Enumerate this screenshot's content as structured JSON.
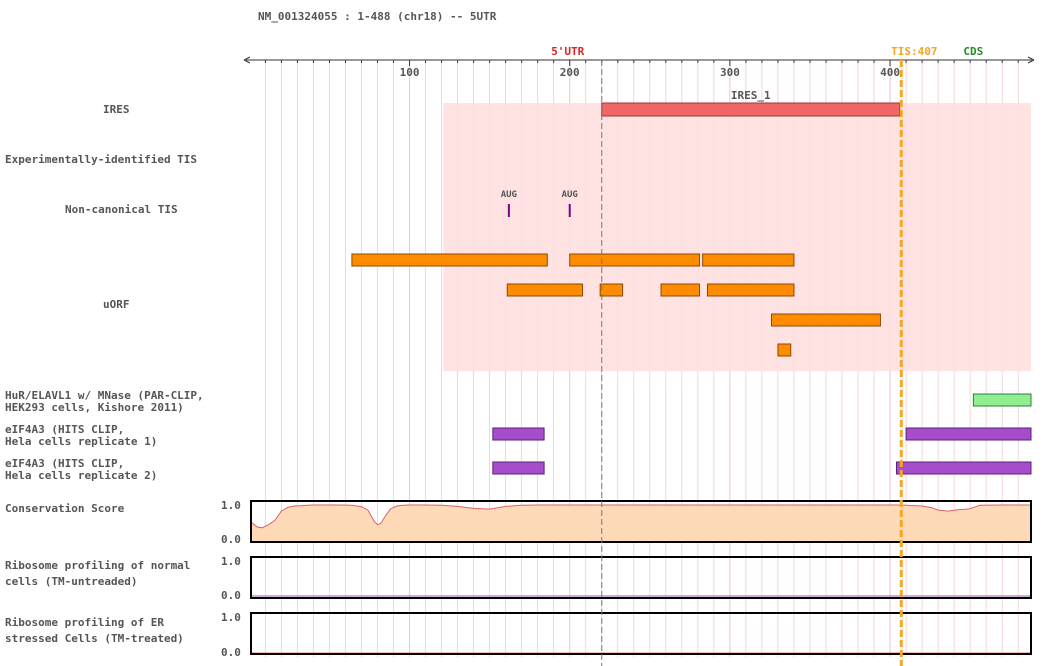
{
  "header": {
    "title": "NM_001324055 : 1-488 (chr18) -- 5UTR"
  },
  "axis": {
    "min": 1,
    "max": 488,
    "major_ticks": [
      100,
      200,
      300,
      400
    ],
    "utr_label": "5'UTR",
    "utr_boundary": 220,
    "tis_label": "TIS:407",
    "tis_position": 407,
    "cds_label": "CDS",
    "cds_label_position": 452
  },
  "colors": {
    "ires_region": "#ffdede",
    "ires_bar": "#f06666",
    "uorf": "#ff8c00",
    "aug_mark": "#800080",
    "hur": "#90ee90",
    "eif4a3": "#a64dcc",
    "conservation_fill": "#ffdab9",
    "conservation_line": "#e06060",
    "tis_line": "#f5a623",
    "utr_label": "#dd2222",
    "cds_label": "#228b22",
    "grid": "#f0c4c4"
  },
  "tracks": {
    "ires": {
      "label": "IRES",
      "region": [
        121,
        488
      ],
      "feature": {
        "name": "IRES_1",
        "start": 220,
        "end": 406
      }
    },
    "exp_tis": {
      "label": "Experimentally-identified TIS"
    },
    "noncanonical_tis": {
      "label": "Non-canonical TIS",
      "marks": [
        {
          "label": "AUG",
          "pos": 162
        },
        {
          "label": "AUG",
          "pos": 200
        }
      ]
    },
    "uorf": {
      "label": "uORF",
      "rows": [
        [
          [
            64,
            186
          ],
          [
            200,
            281
          ],
          [
            283,
            340
          ]
        ],
        [
          [
            161,
            208
          ],
          [
            219,
            233
          ],
          [
            257,
            281
          ],
          [
            286,
            340
          ]
        ],
        [
          [
            326,
            394
          ]
        ],
        [
          [
            330,
            338
          ]
        ]
      ]
    },
    "hur": {
      "label_lines": [
        "HuR/ELAVL1 w/ MNase (PAR-CLIP,",
        "HEK293 cells, Kishore 2011)"
      ],
      "features": [
        [
          452,
          488
        ]
      ]
    },
    "eif4a3_r1": {
      "label_lines": [
        "eIF4A3 (HITS CLIP,",
        "Hela cells replicate 1)"
      ],
      "features": [
        [
          152,
          184
        ],
        [
          410,
          488
        ]
      ]
    },
    "eif4a3_r2": {
      "label_lines": [
        "eIF4A3 (HITS CLIP,",
        "Hela cells replicate 2)"
      ],
      "features": [
        [
          152,
          184
        ],
        [
          404,
          488
        ]
      ]
    }
  },
  "chart_data": {
    "type": "area",
    "title": "Conservation Score",
    "xlabel": "",
    "ylabel": "",
    "ylim": [
      0,
      1
    ],
    "ytick_labels": [
      "1.0",
      "0.0"
    ],
    "x": [
      1,
      5,
      8,
      12,
      16,
      20,
      24,
      28,
      32,
      36,
      40,
      48,
      56,
      64,
      70,
      74,
      76,
      78,
      80,
      82,
      85,
      88,
      92,
      96,
      100,
      110,
      120,
      130,
      140,
      150,
      160,
      170,
      180,
      190,
      200,
      220,
      260,
      300,
      340,
      380,
      405,
      410,
      420,
      426,
      430,
      436,
      442,
      446,
      450,
      456,
      470,
      488
    ],
    "series": [
      {
        "values": [
          0.5,
          0.35,
          0.33,
          0.42,
          0.55,
          0.82,
          0.93,
          0.97,
          0.98,
          0.99,
          1.0,
          1.0,
          1.0,
          0.99,
          0.95,
          0.85,
          0.68,
          0.52,
          0.42,
          0.46,
          0.68,
          0.88,
          0.97,
          0.99,
          1.0,
          1.0,
          0.99,
          0.96,
          0.9,
          0.88,
          0.96,
          0.99,
          1.0,
          1.0,
          1.0,
          1.0,
          1.0,
          1.0,
          1.0,
          1.0,
          1.0,
          0.99,
          0.97,
          0.92,
          0.85,
          0.82,
          0.86,
          0.87,
          0.89,
          0.99,
          1.0,
          1.0
        ]
      }
    ]
  },
  "ribosome_normal": {
    "label_lines": [
      "Ribosome profiling of normal",
      "cells (TM-untreaded)"
    ],
    "ytick_labels": [
      "1.0",
      "0.0"
    ],
    "line_color": "#9b59b6"
  },
  "ribosome_er": {
    "label_lines": [
      "Ribosome profiling of ER",
      "stressed Cells (TM-treated)"
    ],
    "ytick_labels": [
      "1.0",
      "0.0"
    ],
    "line_color": "#e07a7a"
  }
}
